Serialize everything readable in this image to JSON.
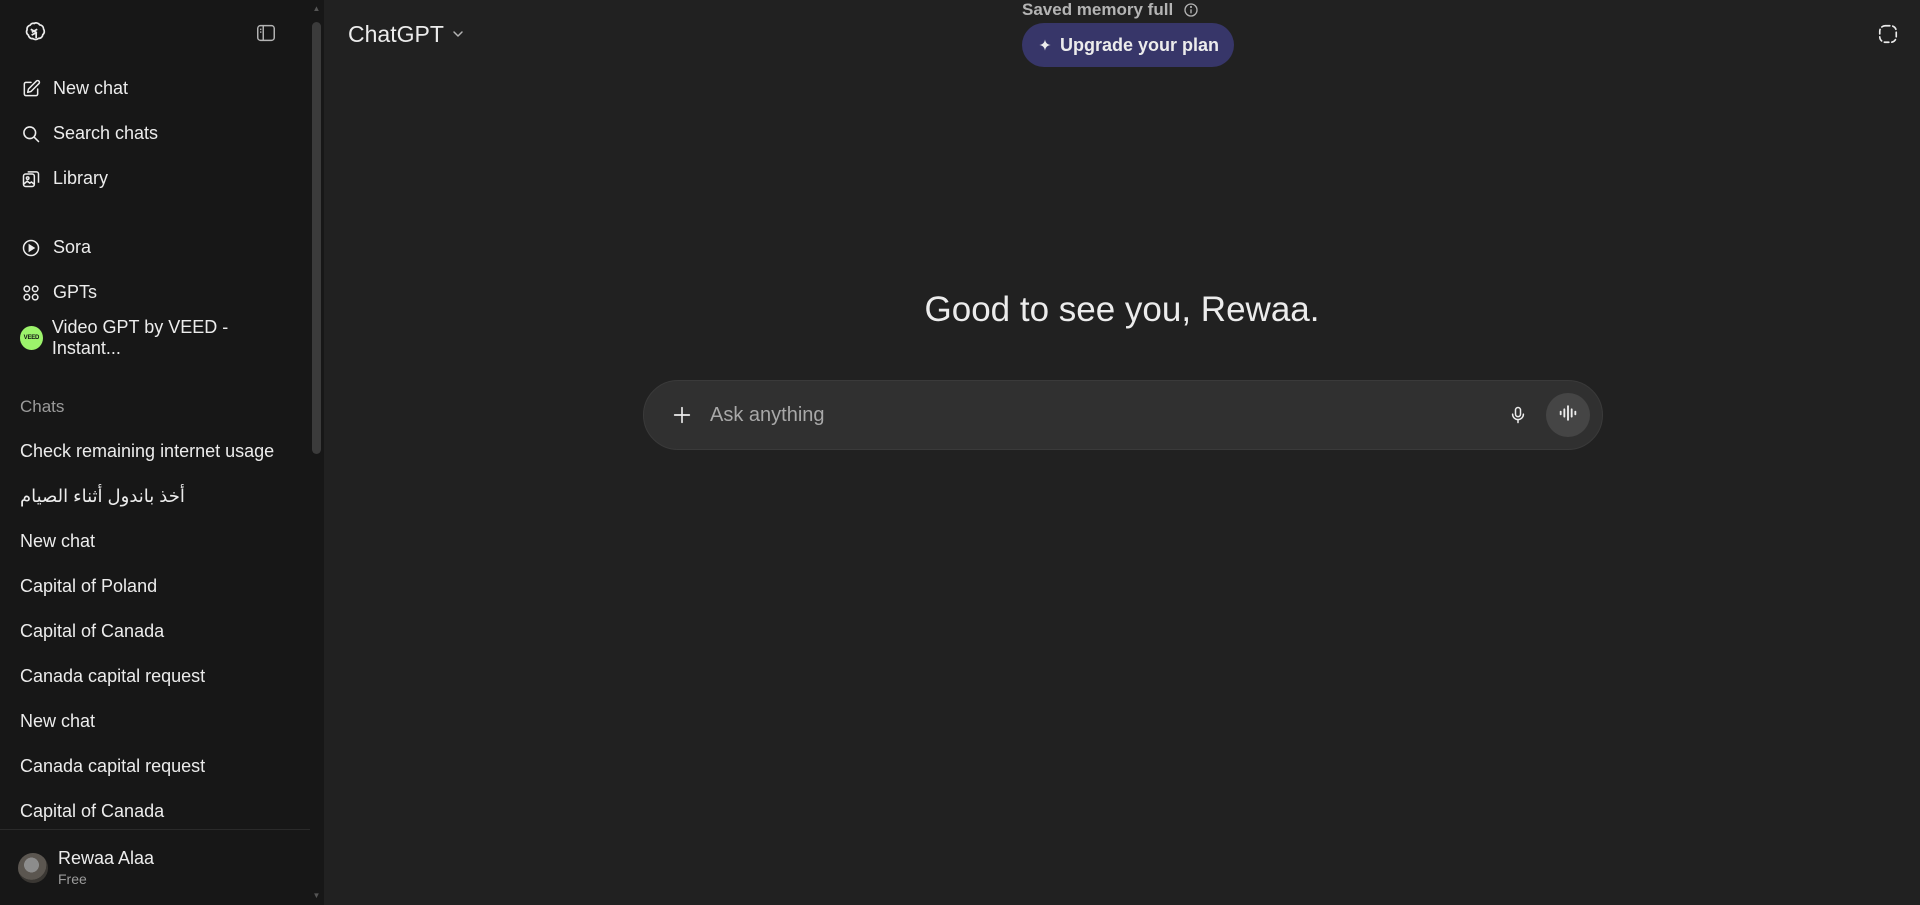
{
  "sidebar": {
    "nav": [
      {
        "label": "New chat",
        "icon": "edit-icon"
      },
      {
        "label": "Search chats",
        "icon": "search-icon"
      },
      {
        "label": "Library",
        "icon": "library-icon"
      }
    ],
    "explore": [
      {
        "label": "Sora",
        "icon": "play-icon"
      },
      {
        "label": "GPTs",
        "icon": "grid-icon"
      },
      {
        "label": "Video GPT by VEED - Instant...",
        "icon": "veed-icon",
        "badge": "VEED"
      }
    ],
    "chats_title": "Chats",
    "chats": [
      "Check remaining internet usage",
      "أخذ باندول أثناء الصيام",
      "New chat",
      "Capital of Poland",
      "Capital of Canada",
      "Canada capital request",
      "New chat",
      "Canada capital request",
      "Capital of Canada"
    ],
    "user": {
      "name": "Rewaa Alaa",
      "plan": "Free"
    }
  },
  "header": {
    "model": "ChatGPT",
    "memory_notice": "Saved memory full",
    "upgrade_label": "Upgrade your plan"
  },
  "main": {
    "greeting": "Good to see you, Rewaa.",
    "composer_placeholder": "Ask anything"
  },
  "colors": {
    "sidebar_bg": "#171717",
    "main_bg": "#212121",
    "composer_bg": "#303030",
    "upgrade_bg": "#373669",
    "veed_green": "#9cf36b"
  }
}
